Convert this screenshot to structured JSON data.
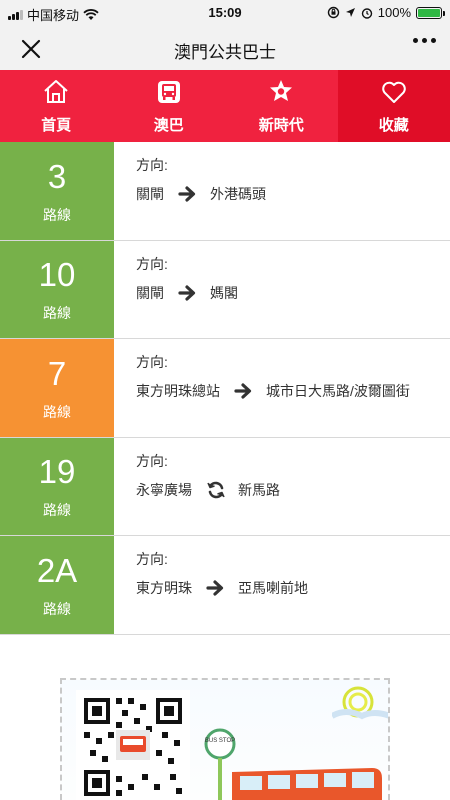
{
  "status_bar": {
    "carrier": "中国移动",
    "time": "15:09",
    "battery": "100%",
    "battery_level": 1.0
  },
  "nav": {
    "title": "澳門公共巴士",
    "close_icon": "close-icon",
    "more_icon": "more-icon"
  },
  "tabs": [
    {
      "label": "首頁",
      "icon": "home-icon"
    },
    {
      "label": "澳巴",
      "icon": "bus-icon"
    },
    {
      "label": "新時代",
      "icon": "star-flower-icon"
    },
    {
      "label": "收藏",
      "icon": "heart-icon",
      "active": true
    }
  ],
  "routes": [
    {
      "number": "3",
      "label": "路線",
      "direction_label": "方向:",
      "from": "關閘",
      "to": "外港碼頭",
      "icon": "arrow-right-icon",
      "color": "#77b14a"
    },
    {
      "number": "10",
      "label": "路線",
      "direction_label": "方向:",
      "from": "關閘",
      "to": "媽閣",
      "icon": "arrow-right-icon",
      "color": "#77b14a"
    },
    {
      "number": "7",
      "label": "路線",
      "direction_label": "方向:",
      "from": "東方明珠總站",
      "to": "城市日大馬路/波爾圖街",
      "icon": "arrow-right-icon",
      "color": "#f69233"
    },
    {
      "number": "19",
      "label": "路線",
      "direction_label": "方向:",
      "from": "永寧廣場",
      "to": "新馬路",
      "icon": "loop-icon",
      "color": "#77b14a"
    },
    {
      "number": "2A",
      "label": "路線",
      "direction_label": "方向:",
      "from": "東方明珠",
      "to": "亞馬喇前地",
      "icon": "arrow-right-icon",
      "color": "#77b14a"
    }
  ],
  "poster": {
    "bus_stop_sign": "BUS STOP",
    "qr_icon": "qr-code-icon"
  },
  "colors": {
    "tab_bar": "#f0223f",
    "tab_active": "#e00d27",
    "green_route": "#77b14a",
    "orange_route": "#f69233"
  }
}
